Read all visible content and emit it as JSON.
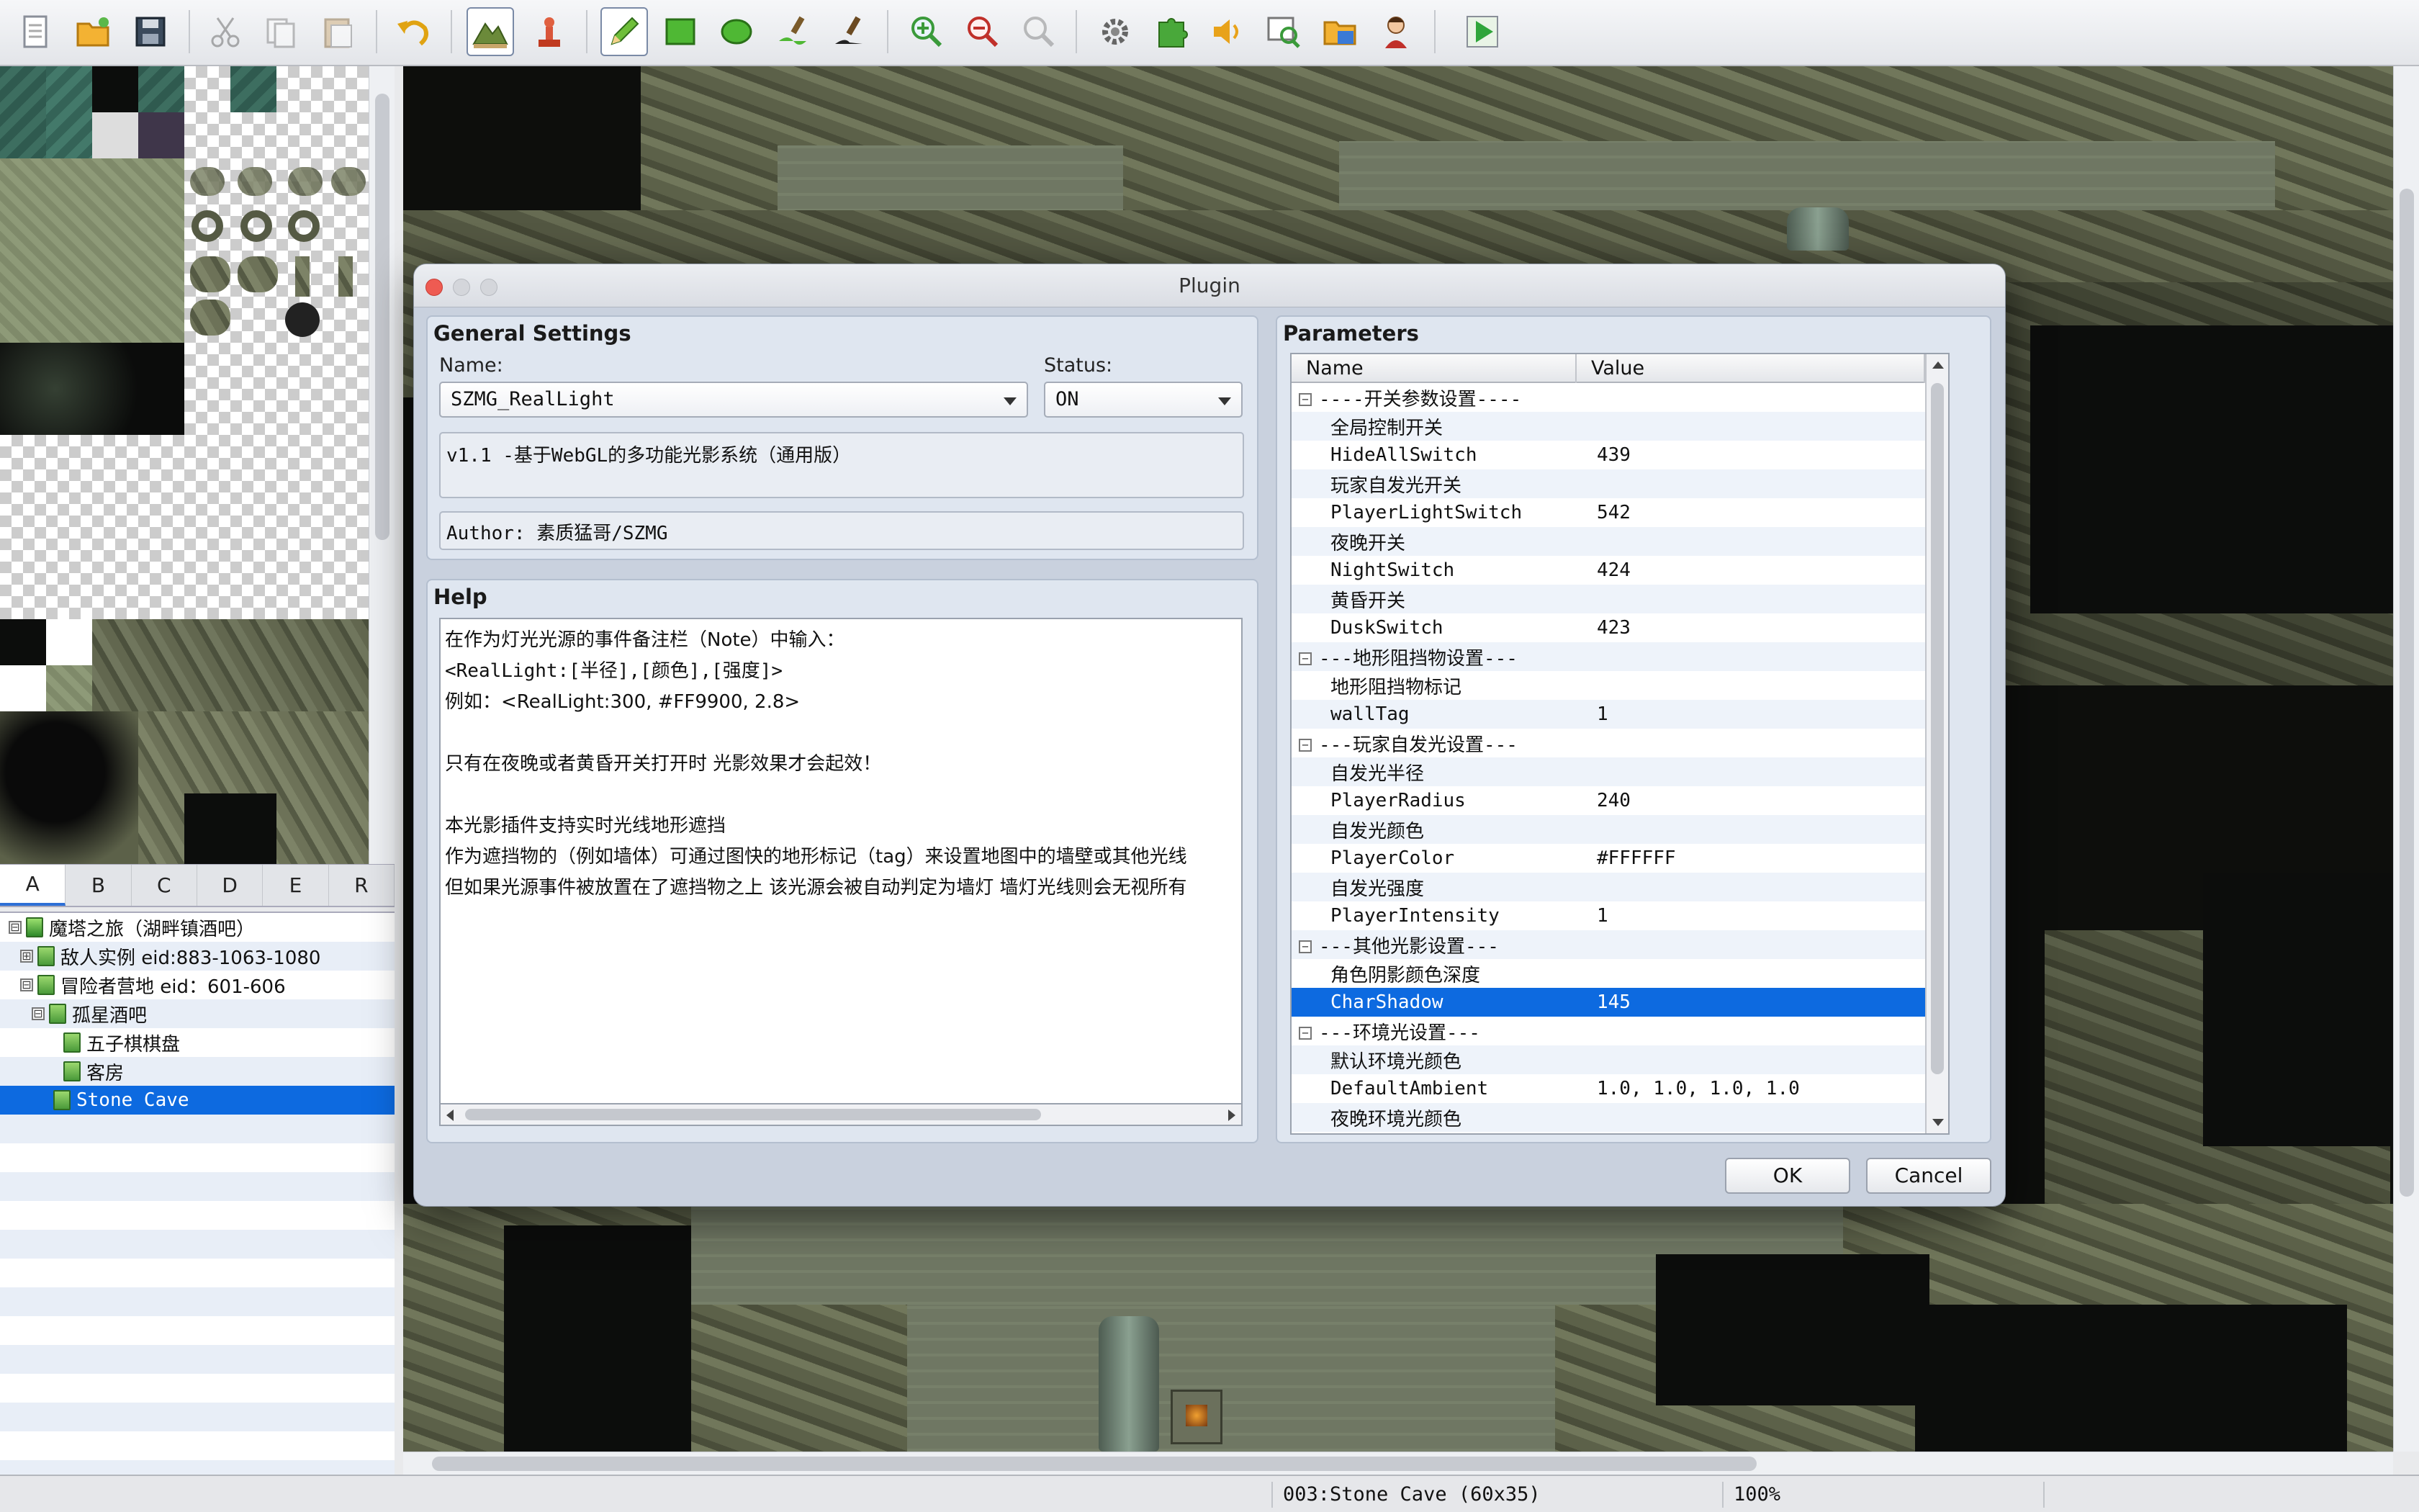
{
  "toolbar": {
    "buttons": [
      {
        "name": "new-project-icon"
      },
      {
        "name": "open-project-icon"
      },
      {
        "name": "save-project-icon"
      },
      {
        "name": "cut-icon"
      },
      {
        "name": "copy-icon"
      },
      {
        "name": "paste-icon"
      },
      {
        "name": "undo-icon"
      },
      {
        "name": "map-mode-icon"
      },
      {
        "name": "event-mode-icon"
      },
      {
        "name": "pencil-icon"
      },
      {
        "name": "rectangle-icon"
      },
      {
        "name": "ellipse-icon"
      },
      {
        "name": "flood-fill-icon"
      },
      {
        "name": "shadow-pen-icon"
      },
      {
        "name": "zoom-in-icon"
      },
      {
        "name": "zoom-out-icon"
      },
      {
        "name": "actual-size-icon"
      },
      {
        "name": "database-icon"
      },
      {
        "name": "plugin-manager-icon"
      },
      {
        "name": "sound-test-icon"
      },
      {
        "name": "event-searcher-icon"
      },
      {
        "name": "resource-manager-icon"
      },
      {
        "name": "character-generator-icon"
      },
      {
        "name": "playtest-icon"
      }
    ]
  },
  "tileset": {
    "tabs": [
      "A",
      "B",
      "C",
      "D",
      "E",
      "R"
    ],
    "selected_tab": "A"
  },
  "map_tree": {
    "items": [
      {
        "label": "魔塔之旅（湖畔镇酒吧）",
        "level": 0,
        "expander": "⊟"
      },
      {
        "label": "敌人实例 eid:883-1063-1080",
        "level": 1,
        "expander": "⊞"
      },
      {
        "label": "冒险者营地 eid：601-606",
        "level": 1,
        "expander": "⊟"
      },
      {
        "label": "孤星酒吧",
        "level": 2,
        "expander": "⊟"
      },
      {
        "label": "五子棋棋盘",
        "level": 3,
        "expander": ""
      },
      {
        "label": "客房",
        "level": 3,
        "expander": ""
      },
      {
        "label": "Stone Cave",
        "level": 2,
        "expander": "",
        "selected": true
      }
    ]
  },
  "statusbar": {
    "map_info": "003:Stone Cave (60x35)",
    "zoom": "100%"
  },
  "dialog": {
    "title": "Plugin",
    "general": {
      "heading": "General Settings",
      "name_label": "Name:",
      "name_value": "SZMG_RealLight",
      "status_label": "Status:",
      "status_value": "ON",
      "description": "v1.1 -基于WebGL的多功能光影系统（通用版）",
      "author": "Author: 素质猛哥/SZMG"
    },
    "help": {
      "heading": "Help",
      "lines": [
        "在作为灯光光源的事件备注栏（Note）中输入：",
        "<RealLight:[半径],[颜色],[强度]>",
        "例如：<RealLight:300, #FF9900, 2.8>",
        "",
        "只有在夜晚或者黄昏开关打开时 光影效果才会起效！",
        "",
        "本光影插件支持实时光线地形遮挡",
        "作为遮挡物的（例如墙体）可通过图快的地形标记（tag）来设置地图中的墙壁或其他光线",
        "但如果光源事件被放置在了遮挡物之上 该光源会被自动判定为墙灯 墙灯光线则会无视所有"
      ]
    },
    "params": {
      "heading": "Parameters",
      "col_name": "Name",
      "col_value": "Value",
      "rows": [
        {
          "type": "group",
          "name": "----开关参数设置----"
        },
        {
          "type": "desc",
          "name": "全局控制开关",
          "value": ""
        },
        {
          "type": "param",
          "name": "HideAllSwitch",
          "value": "439"
        },
        {
          "type": "desc",
          "name": "玩家自发光开关",
          "value": ""
        },
        {
          "type": "param",
          "name": "PlayerLightSwitch",
          "value": "542"
        },
        {
          "type": "desc",
          "name": "夜晚开关",
          "value": ""
        },
        {
          "type": "param",
          "name": "NightSwitch",
          "value": "424"
        },
        {
          "type": "desc",
          "name": "黄昏开关",
          "value": ""
        },
        {
          "type": "param",
          "name": "DuskSwitch",
          "value": "423"
        },
        {
          "type": "group",
          "name": "---地形阻挡物设置---"
        },
        {
          "type": "desc",
          "name": "地形阻挡物标记",
          "value": ""
        },
        {
          "type": "param",
          "name": "wallTag",
          "value": "1"
        },
        {
          "type": "group",
          "name": "---玩家自发光设置---"
        },
        {
          "type": "desc",
          "name": "自发光半径",
          "value": ""
        },
        {
          "type": "param",
          "name": "PlayerRadius",
          "value": "240"
        },
        {
          "type": "desc",
          "name": "自发光颜色",
          "value": ""
        },
        {
          "type": "param",
          "name": "PlayerColor",
          "value": "#FFFFFF"
        },
        {
          "type": "desc",
          "name": "自发光强度",
          "value": ""
        },
        {
          "type": "param",
          "name": "PlayerIntensity",
          "value": "1"
        },
        {
          "type": "group",
          "name": "---其他光影设置---"
        },
        {
          "type": "desc",
          "name": "角色阴影颜色深度",
          "value": ""
        },
        {
          "type": "param",
          "name": "CharShadow",
          "value": "145",
          "selected": true
        },
        {
          "type": "group",
          "name": "---环境光设置---"
        },
        {
          "type": "desc",
          "name": "默认环境光颜色",
          "value": ""
        },
        {
          "type": "param",
          "name": "DefaultAmbient",
          "value": "1.0, 1.0, 1.0, 1.0"
        },
        {
          "type": "desc",
          "name": "夜晚环境光颜色",
          "value": ""
        }
      ]
    },
    "ok_label": "OK",
    "cancel_label": "Cancel"
  },
  "colors": {
    "selection": "#0d6ae0",
    "dialog_bg": "#c9d1de",
    "pane_bg": "#dfe6f0"
  }
}
